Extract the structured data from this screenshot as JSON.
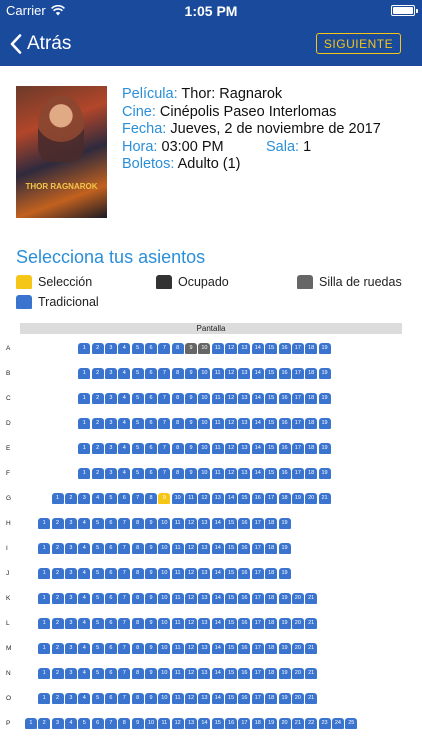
{
  "statusbar": {
    "carrier": "Carrier",
    "time": "1:05 PM"
  },
  "navbar": {
    "back_label": "Atrás",
    "next_label": "SIGUIENTE"
  },
  "movie": {
    "poster_title": "THOR RAGNAROK",
    "pelicula_label": "Película:",
    "pelicula": "Thor: Ragnarok",
    "cine_label": "Cine:",
    "cine": "Cinépolis Paseo Interlomas",
    "fecha_label": "Fecha:",
    "fecha": "Jueves, 2 de noviembre de 2017",
    "hora_label": "Hora:",
    "hora": "03:00 PM",
    "sala_label": "Sala:",
    "sala": "1",
    "boletos_label": "Boletos:",
    "boletos": "Adulto (1)"
  },
  "seat_selection": {
    "title": "Selecciona tus asientos",
    "legend": {
      "seleccion": "Selección",
      "ocupado": "Ocupado",
      "silla_ruedas": "Silla de ruedas",
      "tradicional": "Tradicional"
    },
    "screen_label": "Pantalla"
  },
  "colors": {
    "brand": "#1a4a9c",
    "accent": "#f5c518",
    "label_blue": "#2a8fd9",
    "seat_traditional": "#3a74cf",
    "seat_occupied": "#666666",
    "seat_wheelchair": "#666666",
    "seat_selected": "#f5c518"
  },
  "seat_rows": [
    {
      "label": "A",
      "start": 5,
      "count": 19,
      "occupied": [
        9,
        10
      ],
      "selected": []
    },
    {
      "label": "B",
      "start": 5,
      "count": 19,
      "occupied": [],
      "selected": []
    },
    {
      "label": "C",
      "start": 5,
      "count": 19,
      "occupied": [],
      "selected": []
    },
    {
      "label": "D",
      "start": 5,
      "count": 19,
      "occupied": [],
      "selected": []
    },
    {
      "label": "E",
      "start": 5,
      "count": 19,
      "occupied": [],
      "selected": []
    },
    {
      "label": "F",
      "start": 5,
      "count": 19,
      "occupied": [],
      "selected": []
    },
    {
      "label": "G",
      "start": 3,
      "count": 21,
      "occupied": [],
      "selected": [
        9
      ]
    },
    {
      "label": "H",
      "start": 2,
      "count": 19,
      "occupied": [],
      "selected": []
    },
    {
      "label": "I",
      "start": 2,
      "count": 19,
      "occupied": [],
      "selected": []
    },
    {
      "label": "J",
      "start": 2,
      "count": 19,
      "occupied": [],
      "selected": []
    },
    {
      "label": "K",
      "start": 2,
      "count": 21,
      "occupied": [],
      "selected": []
    },
    {
      "label": "L",
      "start": 2,
      "count": 21,
      "occupied": [],
      "selected": []
    },
    {
      "label": "M",
      "start": 2,
      "count": 21,
      "occupied": [],
      "selected": []
    },
    {
      "label": "N",
      "start": 2,
      "count": 21,
      "occupied": [],
      "selected": []
    },
    {
      "label": "O",
      "start": 2,
      "count": 21,
      "occupied": [],
      "selected": []
    },
    {
      "label": "P",
      "start": 1,
      "count": 25,
      "occupied": [],
      "selected": []
    }
  ]
}
